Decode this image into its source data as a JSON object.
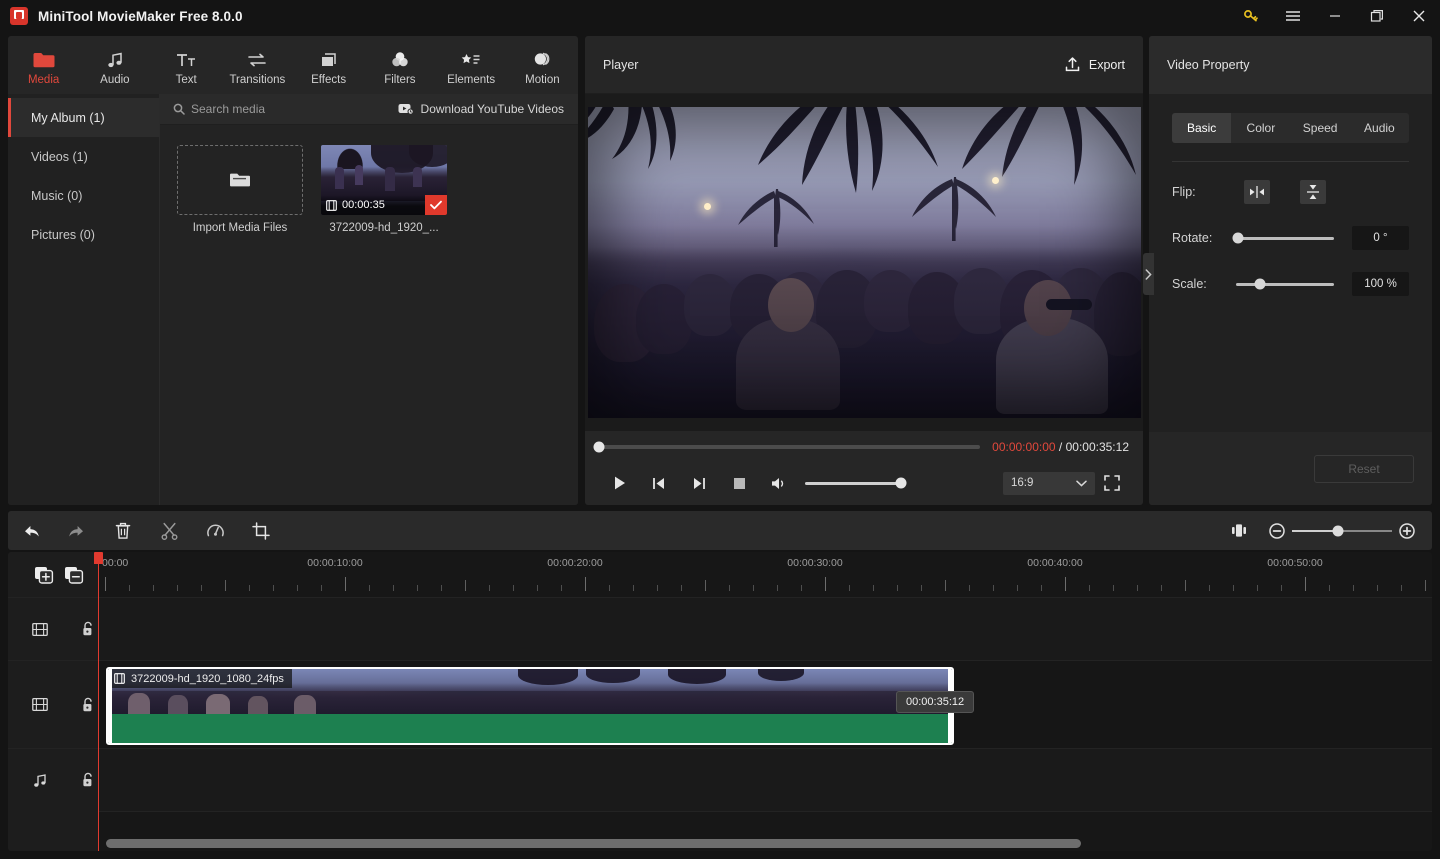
{
  "window": {
    "title": "MiniTool MovieMaker Free 8.0.0",
    "logo_name": "minitool-logo",
    "controls": {
      "key": "key-icon",
      "menu": "menu-icon",
      "minimize": "minimize-icon",
      "maximize": "maximize-icon",
      "close": "close-icon"
    },
    "accent": "#e0483c"
  },
  "tabs": [
    {
      "label": "Media",
      "icon": "folder-icon",
      "active": true
    },
    {
      "label": "Audio",
      "icon": "music-note-icon",
      "active": false
    },
    {
      "label": "Text",
      "icon": "text-tt-icon",
      "active": false
    },
    {
      "label": "Transitions",
      "icon": "transitions-arrows-icon",
      "active": false
    },
    {
      "label": "Effects",
      "icon": "effects-squares-icon",
      "active": false
    },
    {
      "label": "Filters",
      "icon": "filters-circles-icon",
      "active": false
    },
    {
      "label": "Elements",
      "icon": "elements-star-list-icon",
      "active": false
    },
    {
      "label": "Motion",
      "icon": "motion-sphere-icon",
      "active": false
    }
  ],
  "albums": [
    {
      "label": "My Album (1)",
      "active": true
    },
    {
      "label": "Videos (1)",
      "active": false
    },
    {
      "label": "Music (0)",
      "active": false
    },
    {
      "label": "Pictures (0)",
      "active": false
    }
  ],
  "media_bar": {
    "search_placeholder": "Search media",
    "search_icon": "search-icon",
    "download_label": "Download YouTube Videos",
    "download_icon": "youtube-icon"
  },
  "media_items": {
    "import_label": "Import Media Files",
    "import_icon": "folder-icon",
    "clip_label": "3722009-hd_1920_...",
    "clip_duration": "00:00:35",
    "clip_badge_icon": "film-icon",
    "clip_selected_icon": "check-icon"
  },
  "player": {
    "title": "Player",
    "export_label": "Export",
    "export_icon": "upload-icon",
    "current_time": "00:00:00:00",
    "time_separator": "/",
    "total_time": "00:00:35:12",
    "controls": {
      "play": "play-icon",
      "prev_frame": "previous-frame-icon",
      "next_frame": "next-frame-icon",
      "stop": "stop-icon",
      "volume": "volume-icon",
      "fullscreen": "fullscreen-icon"
    },
    "aspect_ratio": "16:9",
    "aspect_chevron": "chevron-down-icon"
  },
  "property": {
    "title": "Video Property",
    "tabs": [
      {
        "label": "Basic",
        "active": true
      },
      {
        "label": "Color",
        "active": false
      },
      {
        "label": "Speed",
        "active": false
      },
      {
        "label": "Audio",
        "active": false
      }
    ],
    "flip_label": "Flip:",
    "flip_horizontal_icon": "flip-horizontal-icon",
    "flip_vertical_icon": "flip-vertical-icon",
    "rotate_label": "Rotate:",
    "rotate_value": "0 °",
    "scale_label": "Scale:",
    "scale_value": "100 %",
    "reset_label": "Reset",
    "collapse_icon": "chevron-right-icon"
  },
  "timeline_toolbar": {
    "buttons": [
      {
        "name": "undo-button",
        "icon": "undo-icon"
      },
      {
        "name": "redo-button",
        "icon": "redo-icon"
      },
      {
        "name": "delete-button",
        "icon": "trash-icon"
      },
      {
        "name": "split-button",
        "icon": "scissors-icon"
      },
      {
        "name": "speed-button",
        "icon": "speed-gauge-icon"
      },
      {
        "name": "crop-button",
        "icon": "crop-icon"
      }
    ],
    "fit_icon": "fit-timeline-icon",
    "zoom_out_icon": "zoom-out-icon",
    "zoom_in_icon": "zoom-in-icon"
  },
  "timeline": {
    "gutter_icons": {
      "add_track": "add-track-icon",
      "remove_track": "remove-track-icon",
      "video_track": "film-icon",
      "audio_track": "music-note-icon",
      "lock": "unlock-icon"
    },
    "ruler_labels": [
      "00:00",
      "00:00:10:00",
      "00:00:20:00",
      "00:00:30:00",
      "00:00:40:00",
      "00:00:50:00"
    ],
    "clip": {
      "title": "3722009-hd_1920_1080_24fps",
      "icon": "film-icon",
      "duration_chip": "00:00:35:12",
      "audio_color": "#1d8050"
    }
  }
}
